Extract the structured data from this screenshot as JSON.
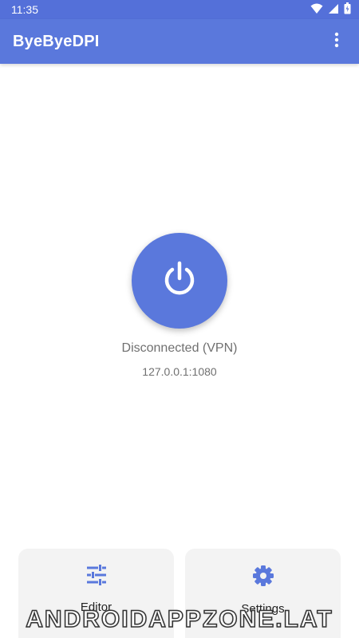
{
  "status_bar": {
    "time": "11:35",
    "icons": [
      "wifi-icon",
      "signal-icon",
      "battery-icon"
    ]
  },
  "app_bar": {
    "title": "ByeByeDPI",
    "menu_icon": "more-vert-icon"
  },
  "main": {
    "power_icon": "power-icon",
    "status": "Disconnected (VPN)",
    "address": "127.0.0.1:1080"
  },
  "bottom_cards": {
    "editor": {
      "label": "Editor",
      "icon": "tune-icon"
    },
    "settings": {
      "label": "Settings",
      "icon": "gear-icon"
    }
  },
  "watermark": "ANDROIDAPPZONE.LAT",
  "colors": {
    "accent": "#5a78dc",
    "status_bar": "#5470d9",
    "card_bg": "#f3f3f3",
    "secondary_text": "#707070"
  }
}
